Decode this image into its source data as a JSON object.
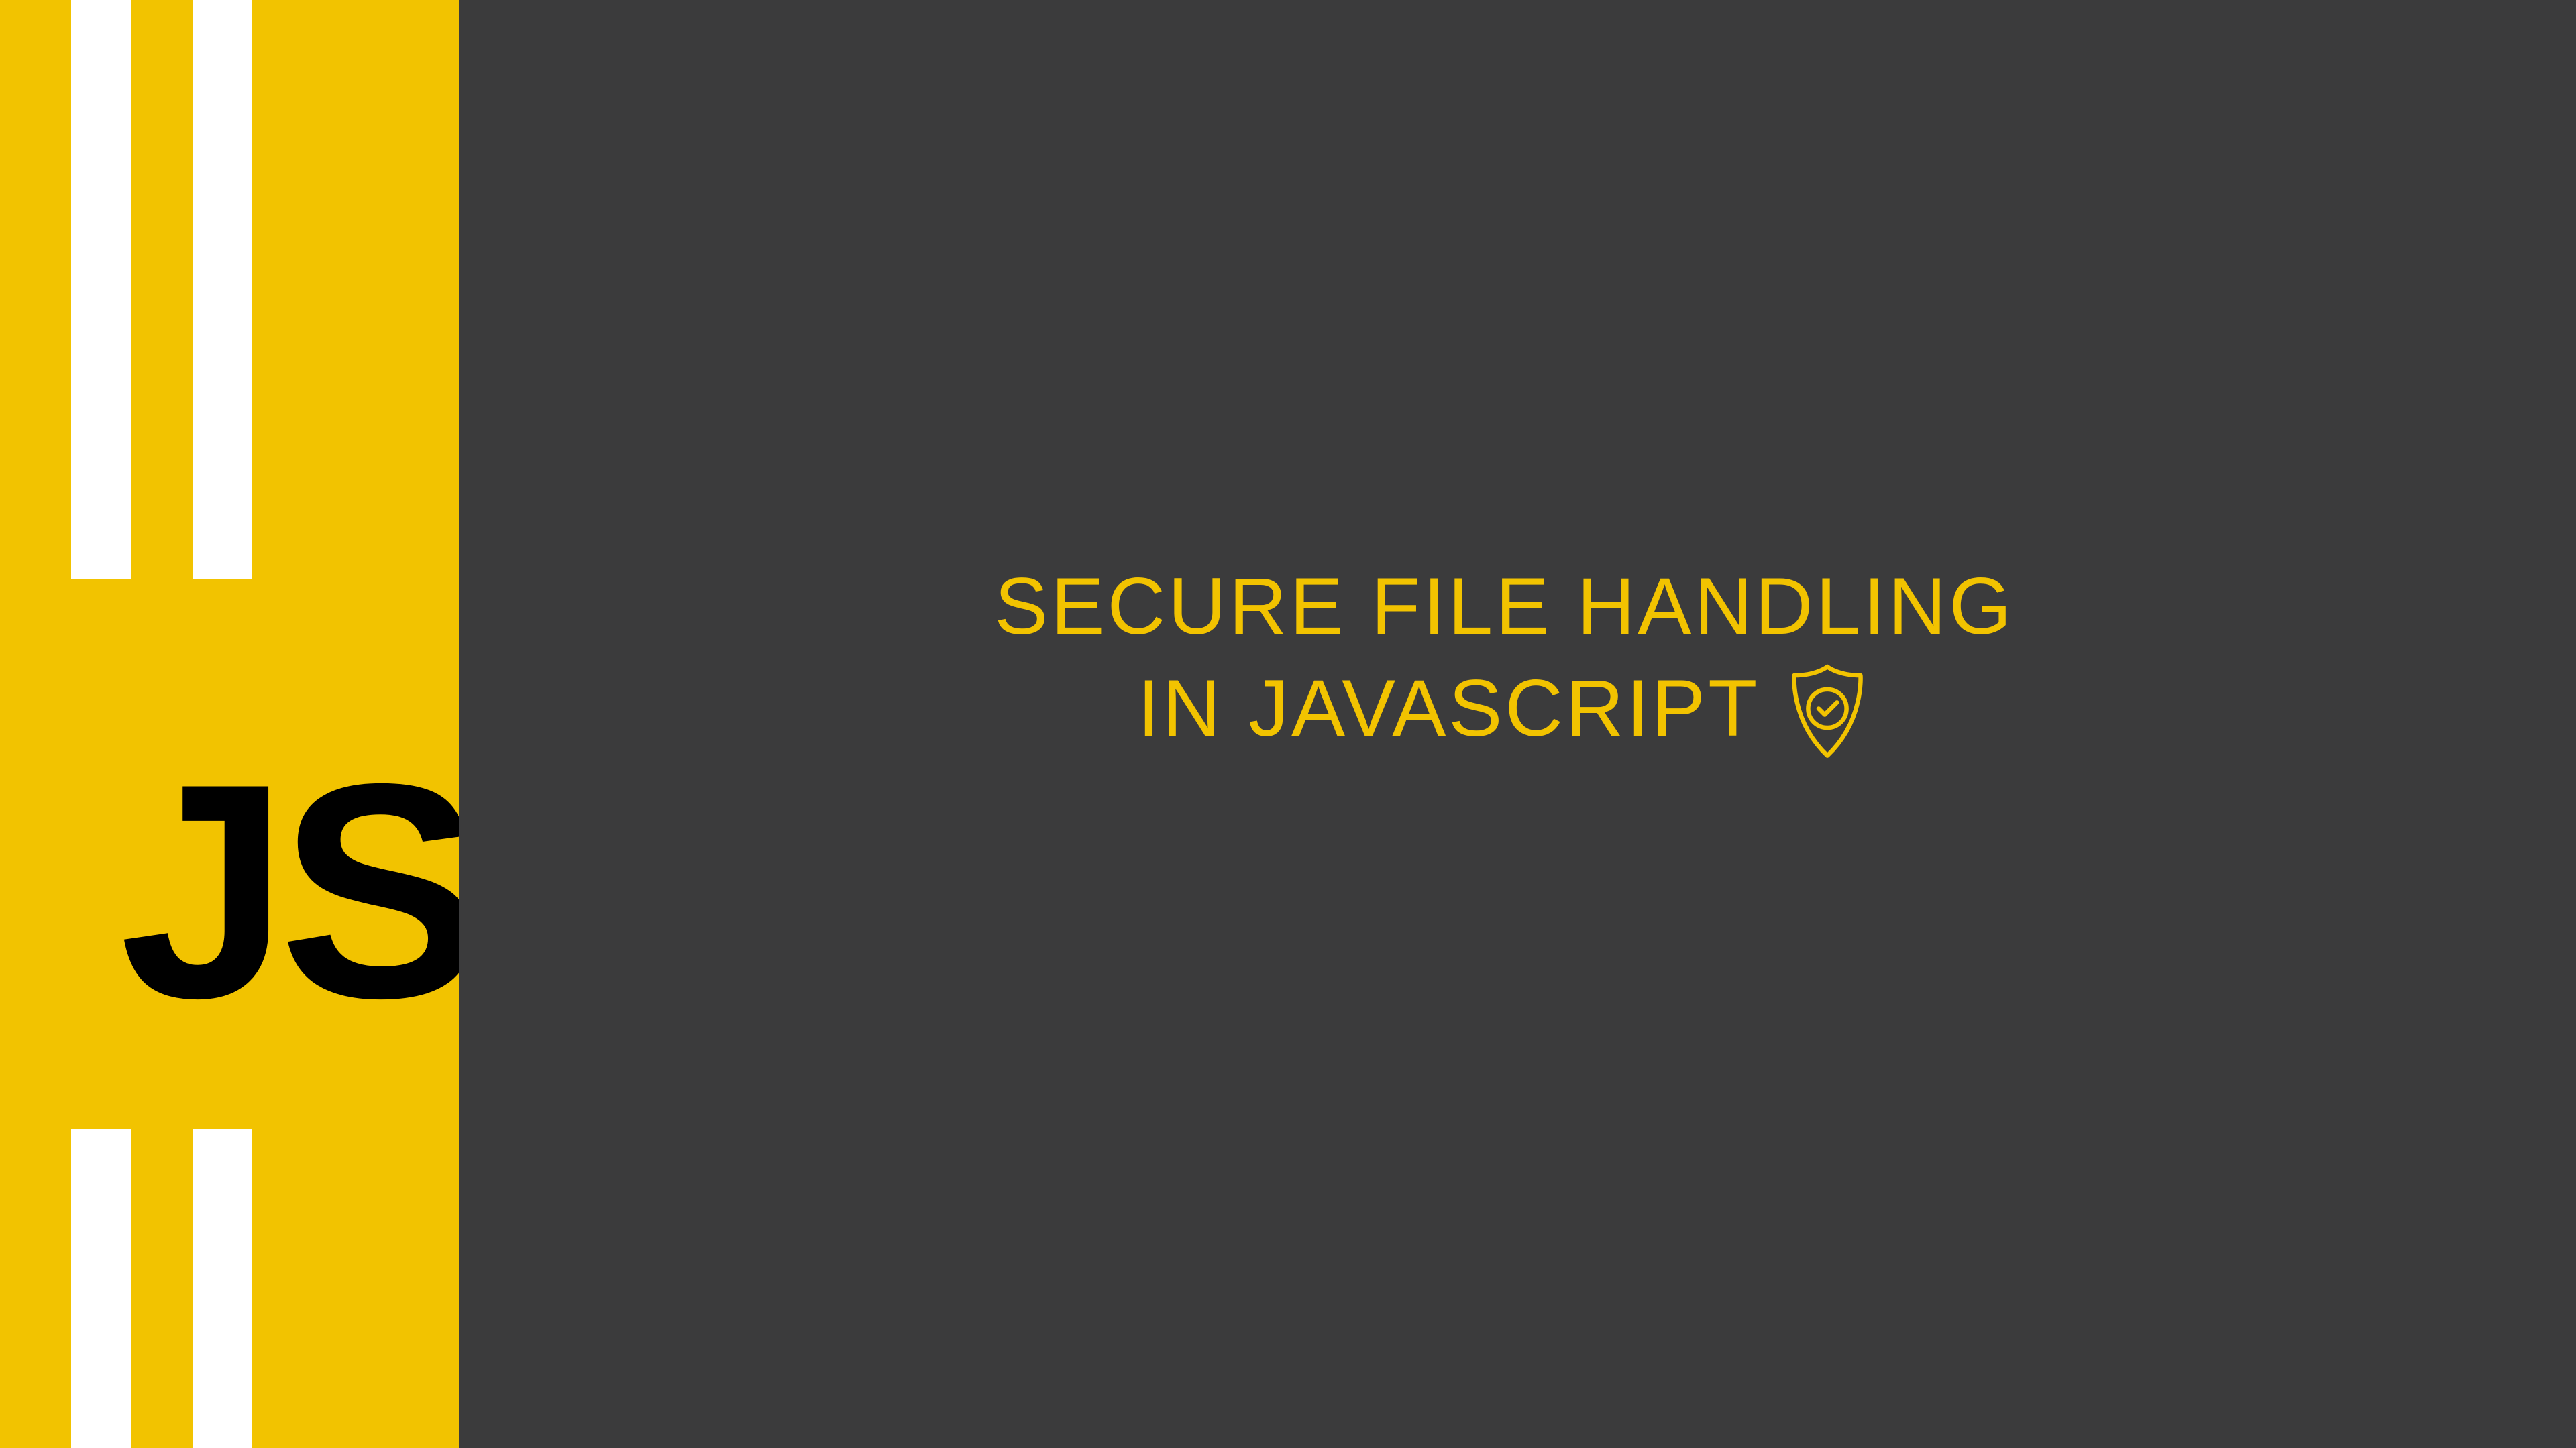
{
  "logo": {
    "text": "JS"
  },
  "title": {
    "line1": "SECURE FILE HANDLING",
    "line2": "IN JAVASCRIPT"
  },
  "colors": {
    "accent": "#f2c300",
    "background": "#3b3b3c",
    "logo_text": "#000000",
    "stripe": "#ffffff"
  }
}
